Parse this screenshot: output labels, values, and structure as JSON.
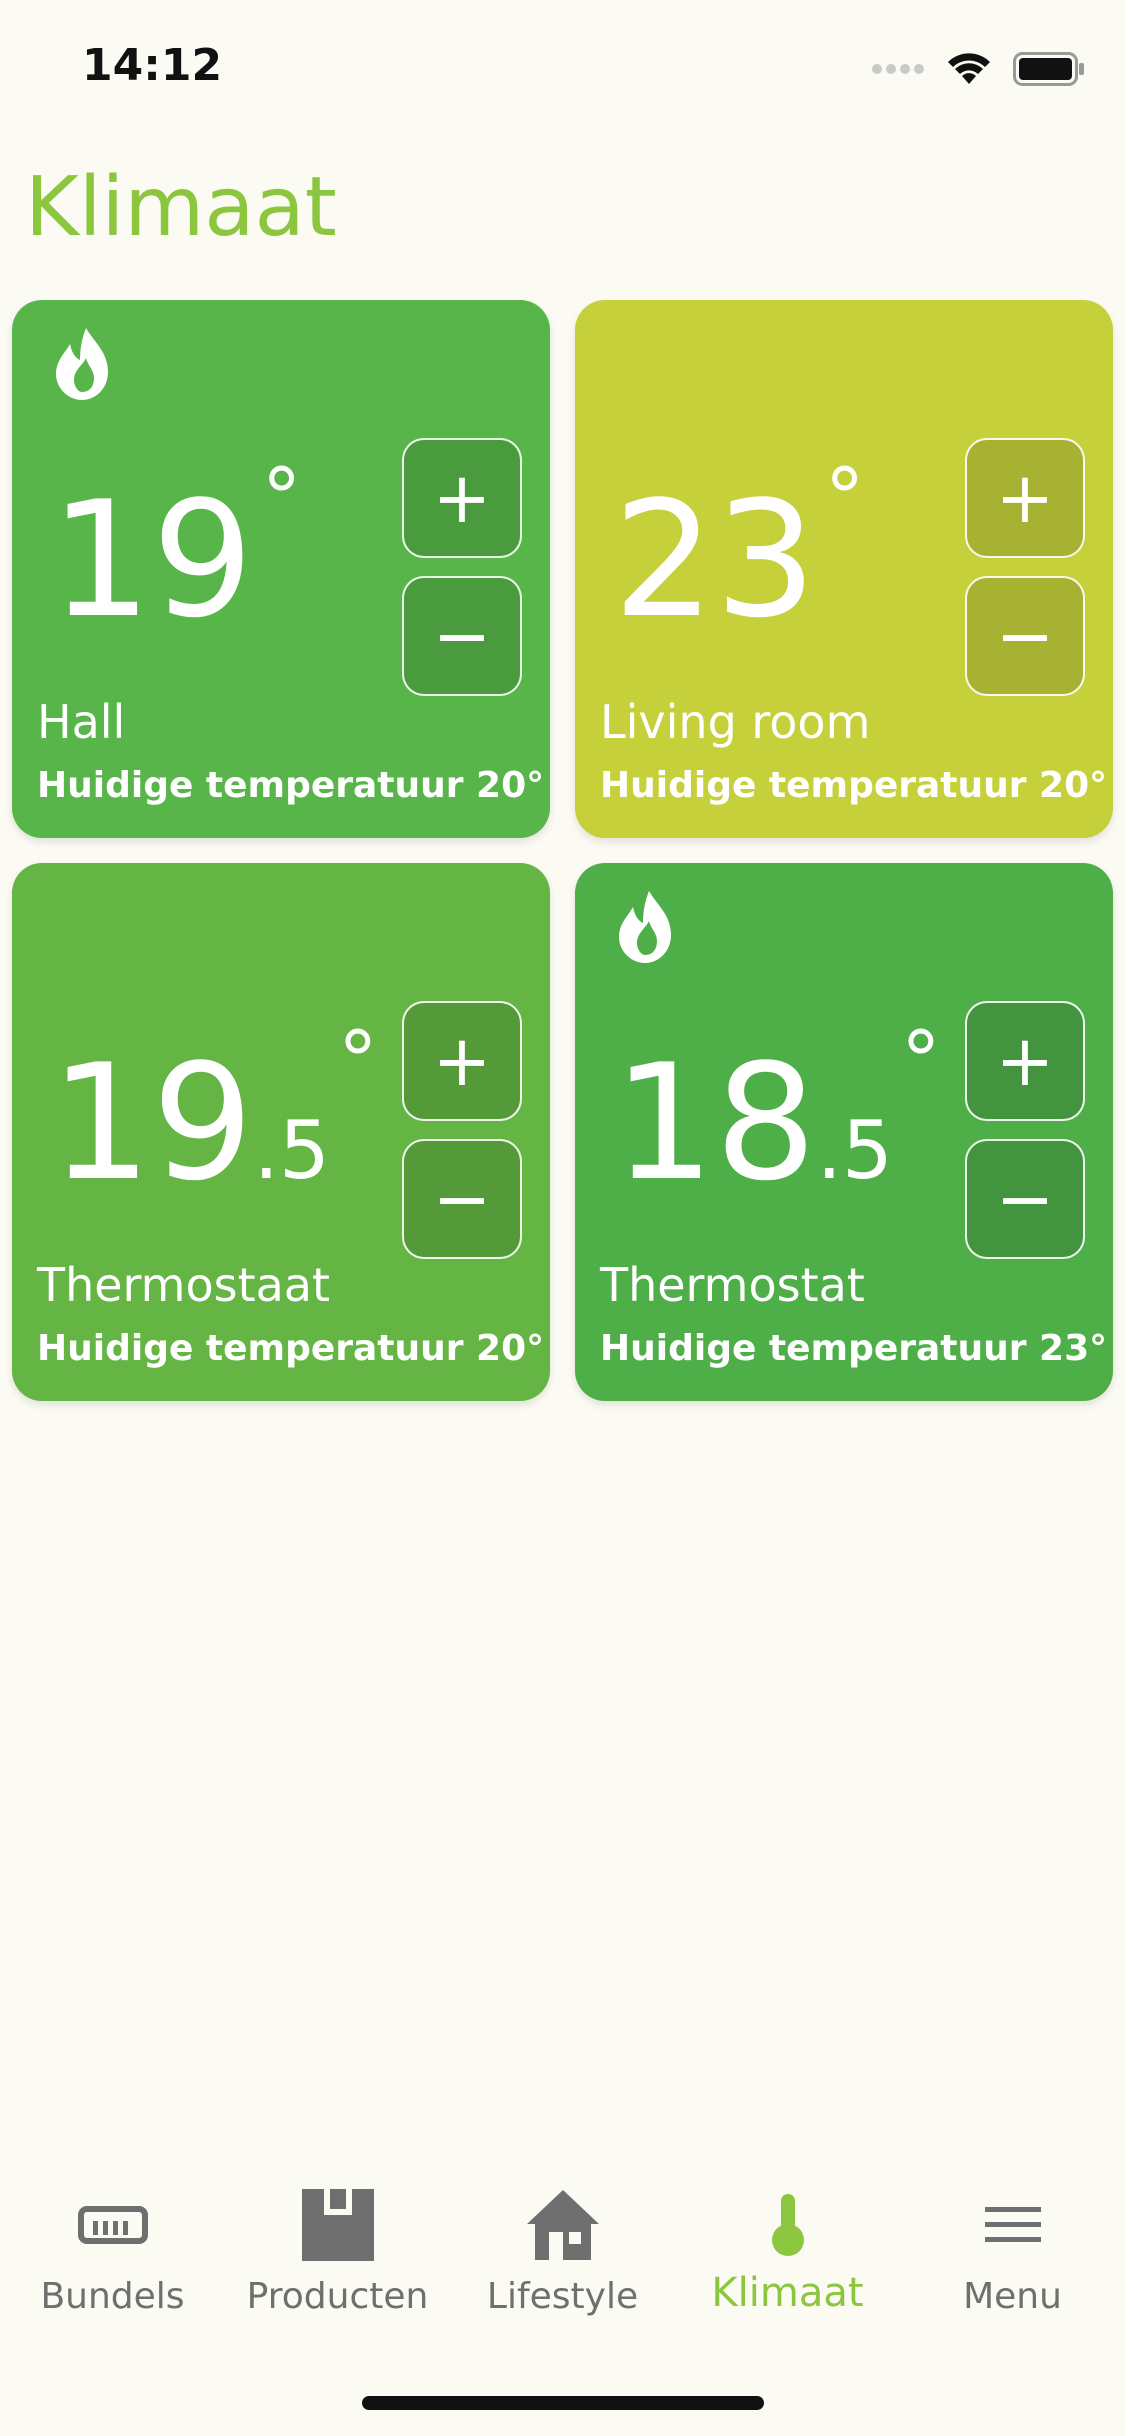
{
  "status": {
    "time": "14:12"
  },
  "header": {
    "title": "Klimaat"
  },
  "tiles": [
    {
      "name": "Hall",
      "temp_int": "19",
      "temp_dec": "",
      "degree": "°",
      "current": "Huidige temperatuur 20°",
      "heating": true,
      "color": "#57b549",
      "plus_label": "+",
      "minus_label": "−"
    },
    {
      "name": "Living room",
      "temp_int": "23",
      "temp_dec": "",
      "degree": "°",
      "current": "Huidige temperatuur 20°",
      "heating": false,
      "color": "#c5d03b",
      "plus_label": "+",
      "minus_label": "−"
    },
    {
      "name": "Thermostaat",
      "temp_int": "19",
      "temp_dec": ".5",
      "degree": "°",
      "current": "Huidige temperatuur 20°",
      "heating": false,
      "color": "#64b544",
      "plus_label": "+",
      "minus_label": "−"
    },
    {
      "name": "Thermostat",
      "temp_int": "18",
      "temp_dec": ".5",
      "degree": "°",
      "current": "Huidige temperatuur 23°",
      "heating": true,
      "color": "#4eaf49",
      "plus_label": "+",
      "minus_label": "−"
    }
  ],
  "tabbar": {
    "items": [
      {
        "label": "Bundels",
        "icon": "ruler-icon",
        "active": false
      },
      {
        "label": "Producten",
        "icon": "box-icon",
        "active": false
      },
      {
        "label": "Lifestyle",
        "icon": "house-icon",
        "active": false
      },
      {
        "label": "Klimaat",
        "icon": "thermometer-icon",
        "active": true
      },
      {
        "label": "Menu",
        "icon": "menu-icon",
        "active": false
      }
    ]
  },
  "colors": {
    "accent": "#8cc63f",
    "inactive_tab": "#6f6f6f",
    "background": "#fbfaf3"
  }
}
